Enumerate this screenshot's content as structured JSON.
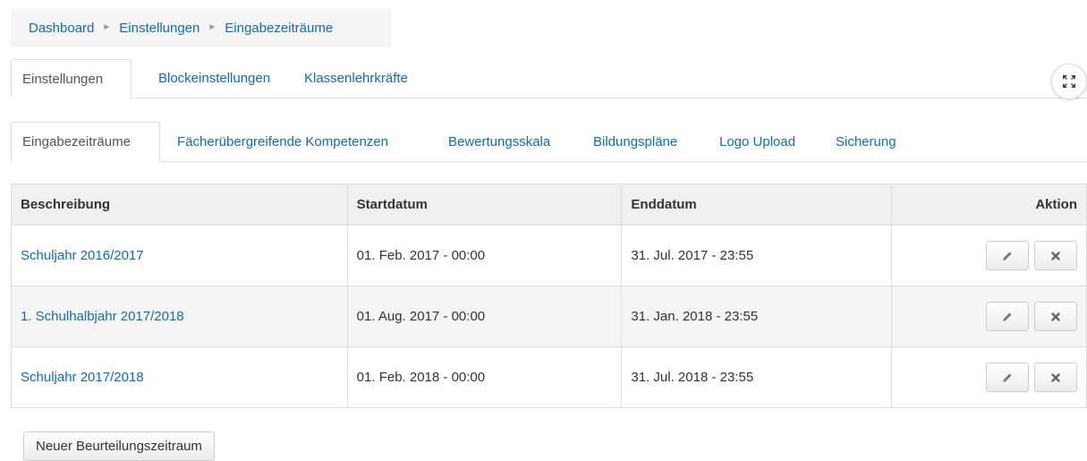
{
  "breadcrumb": {
    "items": [
      "Dashboard",
      "Einstellungen",
      "Eingabezeiträume"
    ],
    "separator": "►"
  },
  "top_tabs": [
    {
      "label": "Einstellungen",
      "active": true
    },
    {
      "label": "Blockeinstellungen",
      "active": false
    },
    {
      "label": "Klassenlehrkräfte",
      "active": false
    }
  ],
  "sub_tabs": [
    {
      "label": "Eingabezeiträume",
      "active": true
    },
    {
      "label": "Fächerübergreifende Kompetenzen",
      "active": false
    },
    {
      "label": "Bewertungsskala",
      "active": false
    },
    {
      "label": "Bildungspläne",
      "active": false
    },
    {
      "label": "Logo Upload",
      "active": false
    },
    {
      "label": "Sicherung",
      "active": false
    }
  ],
  "table": {
    "headers": [
      "Beschreibung",
      "Startdatum",
      "Enddatum",
      "Aktion"
    ],
    "rows": [
      {
        "description": "Schuljahr 2016/2017",
        "start": "01. Feb. 2017 - 00:00",
        "end": "31. Jul. 2017 - 23:55"
      },
      {
        "description": "1. Schulhalbjahr 2017/2018",
        "start": "01. Aug. 2017 - 00:00",
        "end": "31. Jan. 2018 - 23:55"
      },
      {
        "description": "Schuljahr 2017/2018",
        "start": "01. Feb. 2018 - 00:00",
        "end": "31. Jul. 2018 - 23:55"
      }
    ]
  },
  "new_button_label": "Neuer Beurteilungszeitraum",
  "icons": {
    "edit": "pencil-icon",
    "delete": "close-icon",
    "fullscreen": "expand-icon"
  },
  "colors": {
    "link": "#0f6cbf",
    "header_bg": "#f0f0f0",
    "breadcrumb_bg": "#f5f5f5"
  }
}
